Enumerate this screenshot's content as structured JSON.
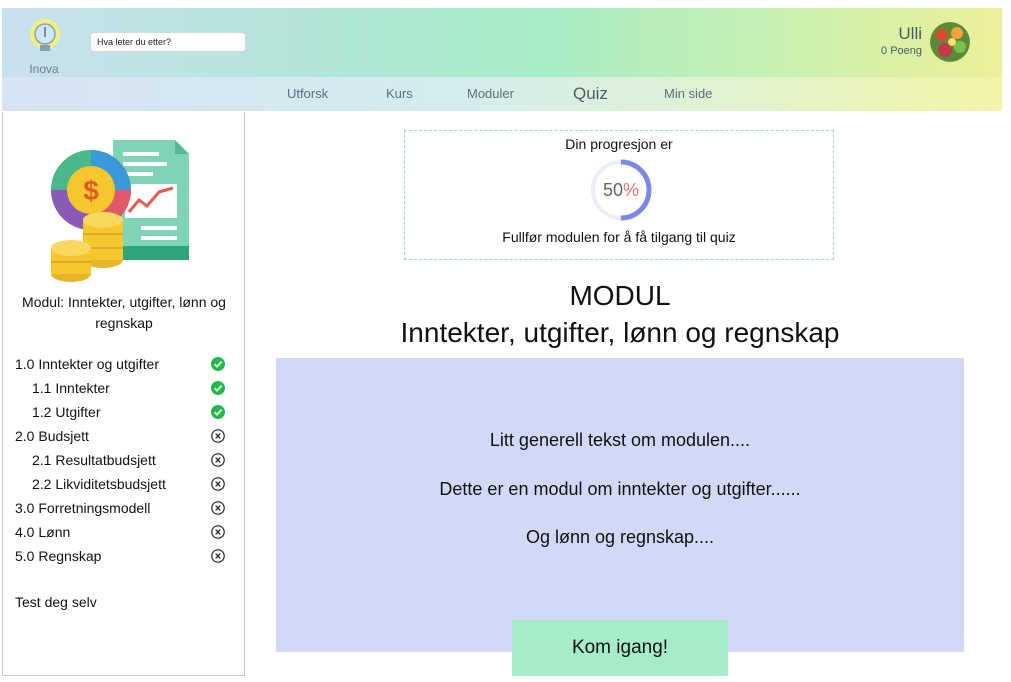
{
  "header": {
    "logo_text": "Inova",
    "search_placeholder": "Hva leter du etter?",
    "user_name": "Ulli",
    "user_points": "0 Poeng"
  },
  "nav": {
    "items": [
      {
        "label": "Utforsk"
      },
      {
        "label": "Kurs"
      },
      {
        "label": "Moduler"
      },
      {
        "label": "Quiz",
        "active": true
      },
      {
        "label": "Min side"
      }
    ]
  },
  "sidebar": {
    "module_title": "Modul: Inntekter, utgifter, lønn og regnskap",
    "items": [
      {
        "label": "1.0  Inntekter og utgifter",
        "status": "complete"
      },
      {
        "label": "1.1   Inntekter",
        "status": "complete"
      },
      {
        "label": "1.2  Utgifter",
        "status": "complete"
      },
      {
        "label": "2.0 Budsjett",
        "status": "incomplete"
      },
      {
        "label": "2.1  Resultatbudsjett",
        "status": "incomplete"
      },
      {
        "label": "2.2 Likviditetsbudsjett",
        "status": "incomplete"
      },
      {
        "label": "3.0 Forretningsmodell",
        "status": "incomplete"
      },
      {
        "label": "4.0 Lønn",
        "status": "incomplete"
      },
      {
        "label": "5.0 Regnskap",
        "status": "incomplete"
      }
    ],
    "test_label": "Test deg selv"
  },
  "progress": {
    "title": "Din progresjon er",
    "value": "50",
    "unit": "%",
    "fraction": 0.5,
    "hint": "Fullfør modulen for å få tilgang til quiz"
  },
  "module": {
    "heading": "MODUL",
    "subheading": "Inntekter, utgifter, lønn og regnskap",
    "lines": [
      "Litt generell tekst om modulen....",
      "Dette er en modul om inntekter og utgifter......",
      "Og lønn og regnskap...."
    ],
    "cta_label": "Kom igang!"
  },
  "colors": {
    "complete": "#22b84a",
    "incomplete": "#222222",
    "panel": "#d1d9f7",
    "cta": "#a6ecc8",
    "ring": "#7b88e6"
  }
}
